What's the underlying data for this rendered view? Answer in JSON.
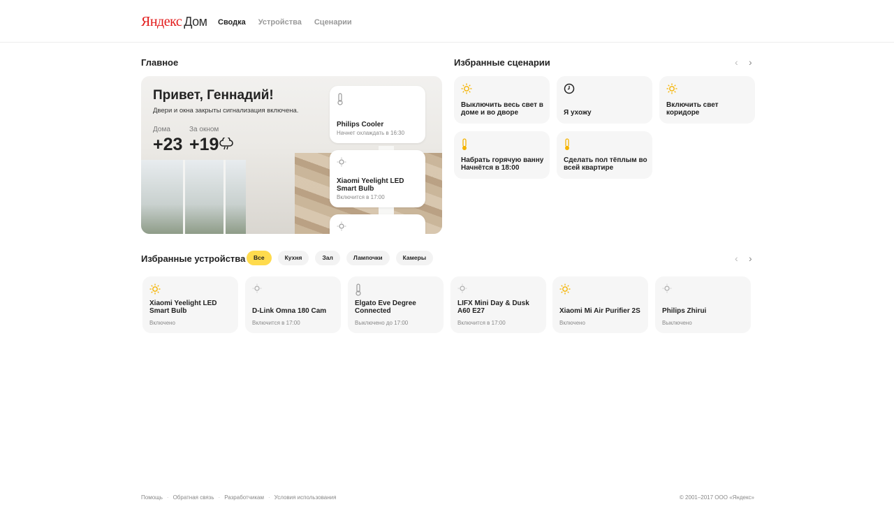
{
  "header": {
    "logo_ya": "Яндекс",
    "logo_dom": "Дом",
    "tabs": [
      {
        "label": "Сводка",
        "active": true
      },
      {
        "label": "Устройства",
        "active": false
      },
      {
        "label": "Сценарии",
        "active": false
      }
    ]
  },
  "main": {
    "title": "Главное",
    "greeting": "Привет, Геннадий!",
    "subtitle": "Двери и окна закрыты сигнализация включена.",
    "home_label": "Дома",
    "home_temp": "+23",
    "outside_label": "За окном",
    "outside_temp": "+19",
    "weather_icon": "cloud-rain-icon",
    "mini_devices": [
      {
        "name": "Philips Cooler",
        "status": "Начнет охлаждать в 16:30",
        "icon": "thermometer-icon"
      },
      {
        "name": "Xiaomi Yeelight LED Smart Bulb",
        "status": "Включится в 17:00",
        "icon": "bulb-icon"
      },
      {
        "name": "",
        "status": "",
        "icon": "bulb-icon"
      }
    ]
  },
  "scenarios": {
    "title": "Избранные сценарии",
    "items": [
      {
        "label": "Выключить весь свет в доме и во дворе",
        "icon": "sun-icon"
      },
      {
        "label": "Я ухожу",
        "icon": "clock-icon"
      },
      {
        "label": "Включить свет коридоре",
        "icon": "sun-icon"
      },
      {
        "label": "Набрать горячую ванну Начнётся в 18:00",
        "icon": "thermometer-icon"
      },
      {
        "label": "Сделать пол тёплым во всей квартире",
        "icon": "thermometer-icon"
      }
    ]
  },
  "devices": {
    "title": "Избранные устройства",
    "filters": [
      {
        "label": "Все",
        "active": true
      },
      {
        "label": "Кухня",
        "active": false
      },
      {
        "label": "Зал",
        "active": false
      },
      {
        "label": "Лампочки",
        "active": false
      },
      {
        "label": "Камеры",
        "active": false
      }
    ],
    "items": [
      {
        "name": "Xiaomi Yeelight LED Smart Bulb",
        "state": "Включено",
        "icon": "sun-icon"
      },
      {
        "name": "D-Link Omna 180 Cam",
        "state": "Включится в 17:00",
        "icon": "bulb-off-icon"
      },
      {
        "name": "Elgato Eve Degree Connected",
        "state": "Выключено до 17:00",
        "icon": "thermometer-icon"
      },
      {
        "name": "LIFX Mini Day & Dusk A60 E27",
        "state": "Включится в 17:00",
        "icon": "bulb-off-icon"
      },
      {
        "name": "Xiaomi Mi Air Purifier 2S",
        "state": "Включено",
        "icon": "sun-icon"
      },
      {
        "name": "Philips Zhirui",
        "state": "Выключено",
        "icon": "bulb-off-icon"
      }
    ]
  },
  "footer": {
    "links": [
      "Помощь",
      "Обратная связь",
      "Разработчикам",
      "Условия использования"
    ],
    "copyright": "© 2001–2017 ООО «Яндекс»"
  },
  "colors": {
    "accent": "#ffdb4d",
    "icon_on": "#f5b301",
    "logo_red": "#e21a1a"
  }
}
